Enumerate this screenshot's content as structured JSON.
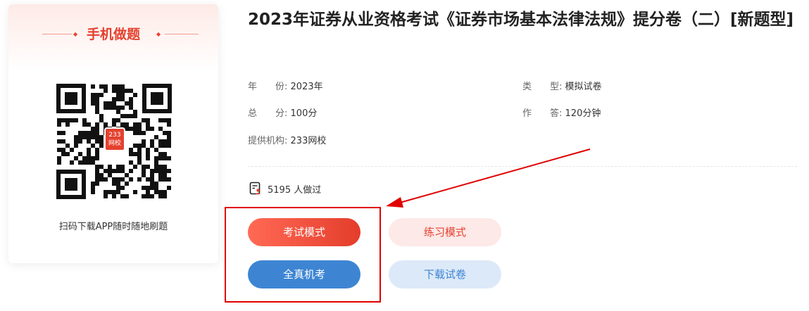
{
  "sidebar": {
    "title": "手机做题",
    "qr_logo_text_1": "233",
    "qr_logo_text_2": "网校",
    "caption": "扫码下载APP随时随地刷题"
  },
  "paper": {
    "title": "2023年证券从业资格考试《证券市场基本法律法规》提分卷（二）[新题型]",
    "year_label": "年　　份:",
    "year_value": "2023年",
    "type_label": "类　　型:",
    "type_value": "模拟试卷",
    "score_label": "总　　分:",
    "score_value": "100分",
    "time_label": "作　　答:",
    "time_value": "120分钟",
    "provider_label": "提供机构:",
    "provider_value": "233网校",
    "done_count": "5195 人做过"
  },
  "buttons": {
    "exam_mode": "考试模式",
    "practice_mode": "练习模式",
    "real_exam": "全真机考",
    "download": "下载试卷"
  },
  "colors": {
    "accent_red": "#e5412f",
    "accent_blue": "#3d85d3",
    "annotation_red": "#e00000"
  }
}
